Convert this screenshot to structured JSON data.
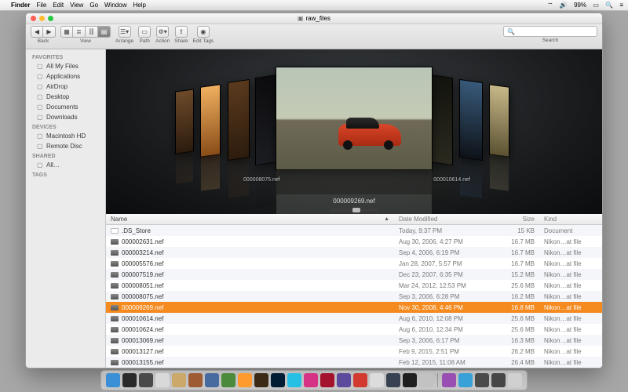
{
  "menubar": {
    "app": "Finder",
    "items": [
      "File",
      "Edit",
      "View",
      "Go",
      "Window",
      "Help"
    ],
    "status": {
      "battery": "99%",
      "clock": ""
    }
  },
  "window": {
    "title": "raw_files",
    "toolbar": {
      "back_label": "Back",
      "view_label": "View",
      "arrange_label": "Arrange",
      "path_label": "Path",
      "action_label": "Action",
      "share_label": "Share",
      "tags_label": "Edit Tags",
      "search_label": "Search"
    }
  },
  "sidebar": {
    "sections": [
      {
        "title": "FAVORITES",
        "items": [
          "All My Files",
          "Applications",
          "AirDrop",
          "Desktop",
          "Documents",
          "Downloads"
        ]
      },
      {
        "title": "DEVICES",
        "items": [
          "Macintosh HD",
          "Remote Disc"
        ]
      },
      {
        "title": "SHARED",
        "items": [
          "All…"
        ]
      },
      {
        "title": "TAGS",
        "items": []
      }
    ]
  },
  "coverflow": {
    "caption": "000009269.nef",
    "left_labels": [
      "000008075.nef"
    ],
    "right_labels": [
      "000010614.nef"
    ]
  },
  "columns": {
    "name": "Name",
    "date": "Date Modified",
    "size": "Size",
    "kind": "Kind"
  },
  "rows": [
    {
      "name": ".DS_Store",
      "date": "Today, 9:37 PM",
      "size": "15 KB",
      "kind": "Document",
      "doc": true
    },
    {
      "name": "000002631.nef",
      "date": "Aug 30, 2006, 4:27 PM",
      "size": "16.7 MB",
      "kind": "Nikon…at file"
    },
    {
      "name": "000003214.nef",
      "date": "Sep 4, 2006, 6:19 PM",
      "size": "16.7 MB",
      "kind": "Nikon…at file"
    },
    {
      "name": "000005576.nef",
      "date": "Jan 28, 2007, 5:57 PM",
      "size": "16.7 MB",
      "kind": "Nikon…at file"
    },
    {
      "name": "000007519.nef",
      "date": "Dec 23, 2007, 6:35 PM",
      "size": "15.2 MB",
      "kind": "Nikon…at file"
    },
    {
      "name": "000008051.nef",
      "date": "Mar 24, 2012, 12:53 PM",
      "size": "25.6 MB",
      "kind": "Nikon…at file"
    },
    {
      "name": "000008075.nef",
      "date": "Sep 3, 2006, 6:28 PM",
      "size": "16.2 MB",
      "kind": "Nikon…at file"
    },
    {
      "name": "000009269.nef",
      "date": "Nov 30, 2008, 4:46 PM",
      "size": "16.8 MB",
      "kind": "Nikon…at file",
      "selected": true
    },
    {
      "name": "000010614.nef",
      "date": "Aug 6, 2010, 12:08 PM",
      "size": "25.6 MB",
      "kind": "Nikon…at file"
    },
    {
      "name": "000010624.nef",
      "date": "Aug 6, 2010, 12:34 PM",
      "size": "25.6 MB",
      "kind": "Nikon…at file"
    },
    {
      "name": "000013069.nef",
      "date": "Sep 3, 2006, 6:17 PM",
      "size": "16.3 MB",
      "kind": "Nikon…at file"
    },
    {
      "name": "000013127.nef",
      "date": "Feb 9, 2015, 2:51 PM",
      "size": "26.2 MB",
      "kind": "Nikon…at file"
    },
    {
      "name": "000013155.nef",
      "date": "Feb 12, 2015, 11:08 AM",
      "size": "26.4 MB",
      "kind": "Nikon…at file"
    }
  ],
  "dock_colors": [
    "#3b8fd6",
    "#2b2b2b",
    "#4a4a4a",
    "#d9d9d9",
    "#caa96a",
    "#9e5a33",
    "#476b9e",
    "#4b8a3a",
    "#ff9a2e",
    "#3a2a16",
    "#001d33",
    "#27c0e5",
    "#d63384",
    "#a4122d",
    "#5c4a9c",
    "#d23a2f",
    "#dcdcdc",
    "#374151",
    "#1f1f1f",
    "#c2c2c2",
    "#994fb2",
    "#3aa0d8",
    "#4a4a4a",
    "#464646",
    "#d0d0d0"
  ]
}
